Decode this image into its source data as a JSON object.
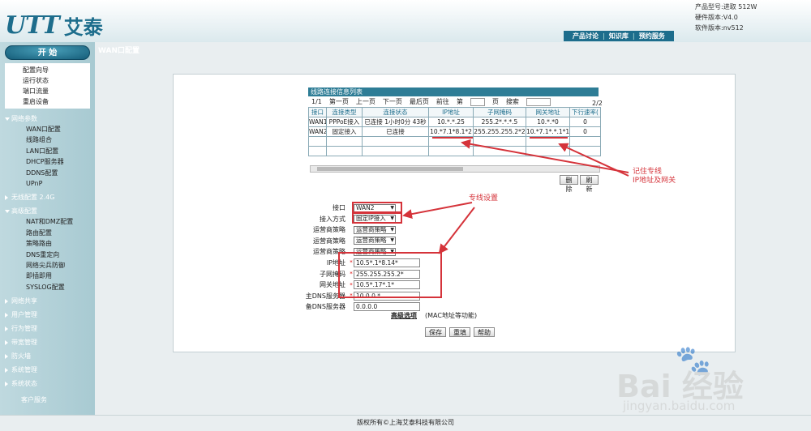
{
  "header": {
    "logo_latin": "UTT",
    "logo_cn": "艾泰",
    "product_model": "产品型号:进取 512W",
    "hardware_version": "硬件版本:V4.0",
    "software_version": "软件版本:nv512",
    "links": [
      "产品讨论",
      "知识库",
      "预约服务"
    ]
  },
  "sidebar": {
    "start_label": "开  始",
    "quick": [
      "配置向导",
      "运行状态",
      "端口流量",
      "重启设备"
    ],
    "categories": [
      {
        "label": "网络参数",
        "open": true,
        "items": [
          "WAN口配置",
          "线路组合",
          "LAN口配置",
          "DHCP服务器",
          "DDNS配置",
          "UPnP"
        ]
      },
      {
        "label": "无线配置 2.4G",
        "open": false,
        "items": []
      },
      {
        "label": "高级配置",
        "open": true,
        "items": [
          "NAT和DMZ配置",
          "路由配置",
          "策略路由",
          "DNS重定向",
          "网络尖兵防御",
          "即插即用",
          "SYSLOG配置"
        ]
      },
      {
        "label": "网络共享",
        "open": false,
        "items": []
      },
      {
        "label": "用户管理",
        "open": false,
        "items": []
      },
      {
        "label": "行为管理",
        "open": false,
        "items": []
      },
      {
        "label": "带宽管理",
        "open": false,
        "items": []
      },
      {
        "label": "防火墙",
        "open": false,
        "items": []
      },
      {
        "label": "系统管理",
        "open": false,
        "items": []
      },
      {
        "label": "系统状态",
        "open": false,
        "items": []
      }
    ],
    "customer_service": "客户服务"
  },
  "page": {
    "title": "WAN口配置"
  },
  "link_table": {
    "heading": "线路连接信息列表",
    "page_count": "2/2",
    "pager": {
      "current": "1/1",
      "first": "第一页",
      "prev": "上一页",
      "next": "下一页",
      "last": "最后页",
      "goto": "前往",
      "di": "第",
      "page": "页",
      "search": "搜索"
    },
    "columns": [
      "接口",
      "连接类型",
      "连接状态",
      "IP地址",
      "子网掩码",
      "网关地址",
      "下行速率("
    ],
    "rows": [
      [
        "WAN1",
        "PPPoE接入",
        "已连接 1小时0分 43秒",
        "10.*.*.25",
        "255.2*.*.*.5",
        "10.*.*0",
        "0"
      ],
      [
        "WAN2",
        "固定接入",
        "已连接",
        "10.*7.1*8.1*2",
        "255.255.255.2*2",
        "10.*7.1*.*.1*1",
        "0"
      ]
    ],
    "empty_rows": 2,
    "delete_btn": "删除",
    "refresh_btn": "刷新"
  },
  "form": {
    "interface_label": "接口",
    "interface_value": "WAN2",
    "access_label": "接入方式",
    "access_value": "固定IP接入",
    "isp_label": "运营商策略",
    "isp_value": "运营商策略",
    "ip_label": "IP地址",
    "ip_value": "10.5*.1*8.14*",
    "mask_label": "子网掩码",
    "mask_value": "255.255.255.2*",
    "gw_label": "网关地址",
    "gw_value": "10.5*.17*.1*",
    "dns1_label": "主DNS服务器",
    "dns1_value": "10.0.0.*",
    "dns2_label": "备DNS服务器",
    "dns2_value": "0.0.0.0",
    "advanced": "高级选项",
    "advanced_note": "(MAC地址等功能)",
    "save_btn": "保存",
    "reset_btn": "重填",
    "help_btn": "帮助"
  },
  "annotations": {
    "note1_line1": "记住专线",
    "note1_line2": "IP地址及网关",
    "note2": "专线设置",
    "color": "#d5333a"
  },
  "footer": {
    "copyright": "版权所有©上海艾泰科技有限公司"
  },
  "watermark": {
    "brand": "Bai  经验",
    "url": "jingyan.baidu.com"
  }
}
